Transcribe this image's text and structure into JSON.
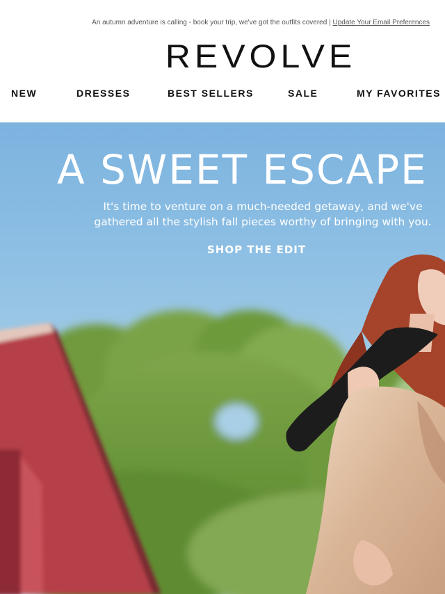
{
  "preheader": {
    "message": "An autumn adventure is calling - book your trip, we've got the outfits covered |",
    "link_label": "Update Your Email Preferences"
  },
  "brand": {
    "logo": "REVOLVE"
  },
  "nav": {
    "items": [
      {
        "label": "NEW"
      },
      {
        "label": "DRESSES"
      },
      {
        "label": "BEST SELLERS"
      },
      {
        "label": "SALE"
      },
      {
        "label": "MY FAVORITES"
      }
    ]
  },
  "hero": {
    "title": "A SWEET ESCAPE",
    "copy_line1": "It's time to venture on a much-needed getaway, and we've",
    "copy_line2": "gathered all the stylish fall pieces worthy of bringing with you.",
    "cta": "SHOP THE EDIT"
  },
  "colors": {
    "sky": "#8fc0e4",
    "trees": "#6f9a3c",
    "barn": "#b8434b",
    "text_on_hero": "#ffffff"
  }
}
